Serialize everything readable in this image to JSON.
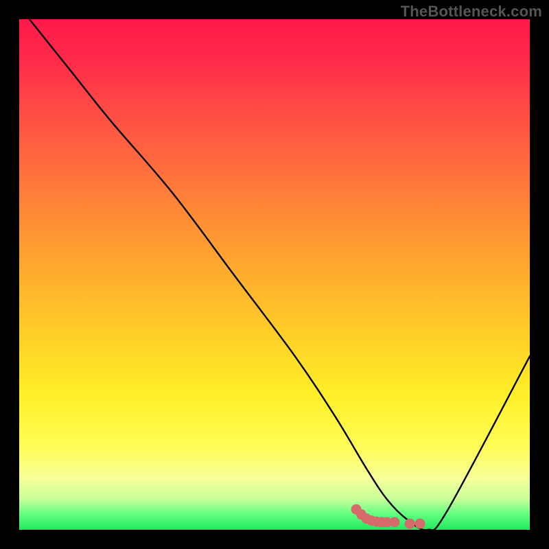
{
  "watermark": {
    "text": "TheBottleneck.com"
  },
  "colors": {
    "frame": "#000000",
    "curve_stroke": "#000000",
    "dot_fill": "#d46a6a",
    "dot_stroke": "#b24e4e"
  },
  "chart_data": {
    "type": "line",
    "title": "",
    "xlabel": "",
    "ylabel": "",
    "xlim": [
      0,
      100
    ],
    "ylim": [
      0,
      100
    ],
    "series": [
      {
        "name": "bottleneck-curve",
        "x": [
          2,
          10,
          18,
          30,
          42,
          54,
          62,
          68,
          72,
          76,
          80,
          84,
          100
        ],
        "y": [
          100,
          90,
          80,
          66,
          50,
          34,
          22,
          12,
          6,
          2,
          0,
          4,
          34
        ]
      }
    ],
    "markers": {
      "name": "optimal-cluster",
      "points": [
        {
          "x": 66,
          "y": 4
        },
        {
          "x": 67,
          "y": 3
        },
        {
          "x": 68,
          "y": 2.2
        },
        {
          "x": 69,
          "y": 1.8
        },
        {
          "x": 70,
          "y": 1.6
        },
        {
          "x": 71,
          "y": 1.5
        },
        {
          "x": 72,
          "y": 1.5
        },
        {
          "x": 73.5,
          "y": 1.5
        },
        {
          "x": 76.5,
          "y": 1.2
        },
        {
          "x": 78.5,
          "y": 1.2
        }
      ]
    }
  }
}
